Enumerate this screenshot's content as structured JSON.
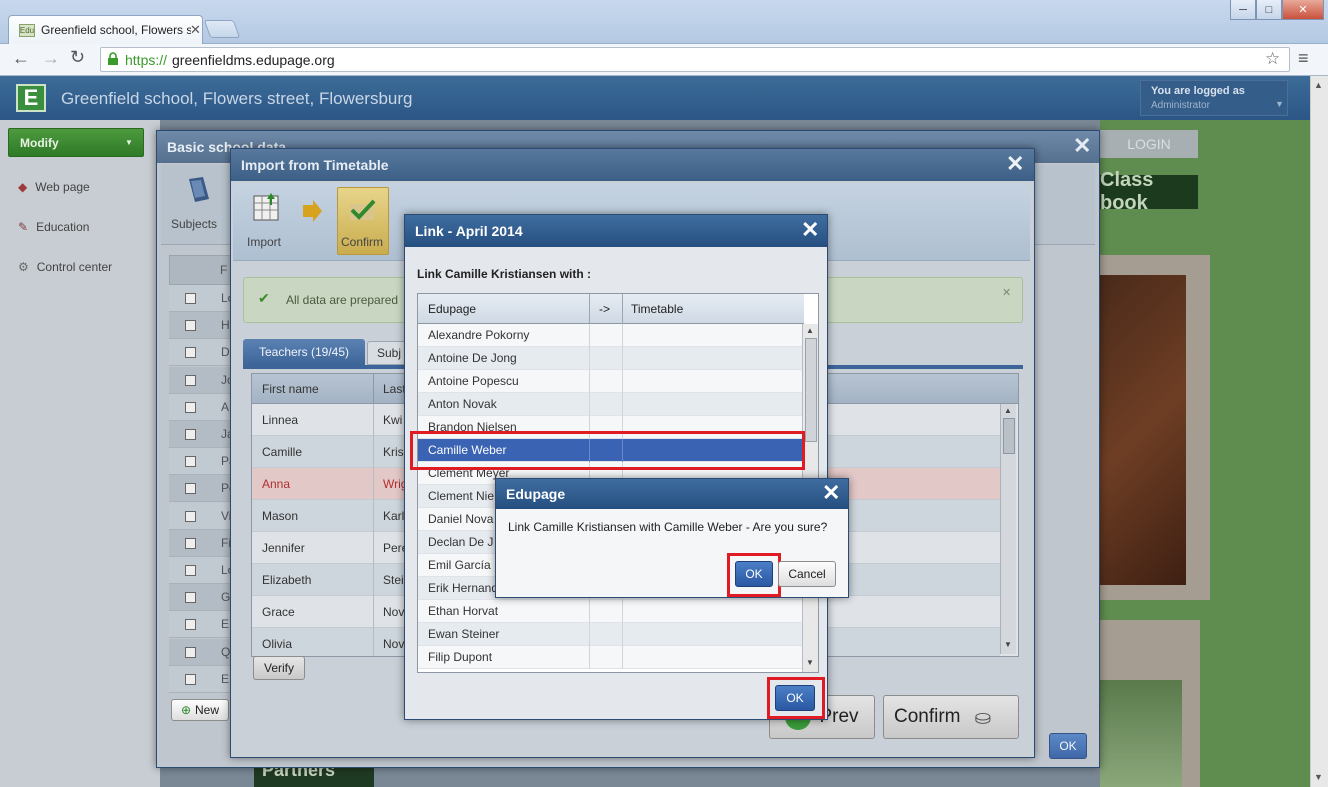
{
  "browser": {
    "tab_title": "Greenfield school, Flowers st",
    "tab_favicon": "Edu",
    "url_scheme": "https://",
    "url_host": "greenfieldms.edupage.org"
  },
  "app": {
    "school_name": "Greenfield school, Flowers street, Flowersburg",
    "logged_as_label": "You are logged as",
    "logged_as_user": "Administrator",
    "login_button": "LOGIN",
    "classbook_label": "Class book",
    "partners_label": "Partners"
  },
  "sidebar": {
    "modify_label": "Modify",
    "items": [
      {
        "label": "Web page",
        "icon": "web-page-icon"
      },
      {
        "label": "Education",
        "icon": "education-icon"
      },
      {
        "label": "Control center",
        "icon": "control-center-icon"
      }
    ]
  },
  "basic_dialog": {
    "title": "Basic school data",
    "tool_subjects": "Subjects",
    "new_button": "New",
    "partial_column": "F",
    "rows_partial": [
      "Lo",
      "Ha",
      "D",
      "Jo",
      "A",
      "Ja",
      "Pa",
      "Pe",
      "Vi",
      "Fi",
      "Lo",
      "G",
      "E",
      "Q",
      "E"
    ],
    "ok_button": "OK"
  },
  "import_dialog": {
    "title": "Import from Timetable",
    "tool_import": "Import",
    "tool_confirm": "Confirm",
    "info_text": "All data are prepared",
    "tab_teachers": "Teachers (19/45)",
    "tab_subjects": "Subj",
    "col_firstname": "First name",
    "col_lastname": "Last",
    "teachers": [
      {
        "first": "Linnea",
        "last": "Kwi"
      },
      {
        "first": "Camille",
        "last": "Kris"
      },
      {
        "first": "Anna",
        "last": "Wrig"
      },
      {
        "first": "Mason",
        "last": "Karl"
      },
      {
        "first": "Jennifer",
        "last": "Pere"
      },
      {
        "first": "Elizabeth",
        "last": "Stei"
      },
      {
        "first": "Grace",
        "last": "Nov"
      },
      {
        "first": "Olivia",
        "last": "Nov"
      }
    ],
    "verify_button": "Verify",
    "prev_button": "Prev",
    "confirm_button": "Confirm"
  },
  "link_dialog": {
    "title": "Link - April 2014",
    "subtitle": "Link Camille Kristiansen with :",
    "col_edupage": "Edupage",
    "col_arrow": "->",
    "col_timetable": "Timetable",
    "rows": [
      "Alexandre Pokorny",
      "Antoine De Jong",
      "Antoine Popescu",
      "Anton Novak",
      "Brandon Nielsen",
      "Camille Weber",
      "Clement Meyer",
      "Clement Nie",
      "Daniel Nova",
      "Declan De J",
      "Emil García",
      "Erik Hernand",
      "Ethan Horvat",
      "Ewan Steiner",
      "Filip Dupont"
    ],
    "selected_row": "Camille Weber",
    "ok_button": "OK"
  },
  "confirm_dialog": {
    "title": "Edupage",
    "message": "Link Camille Kristiansen with Camille Weber - Are you sure?",
    "ok_button": "OK",
    "cancel_button": "Cancel"
  }
}
